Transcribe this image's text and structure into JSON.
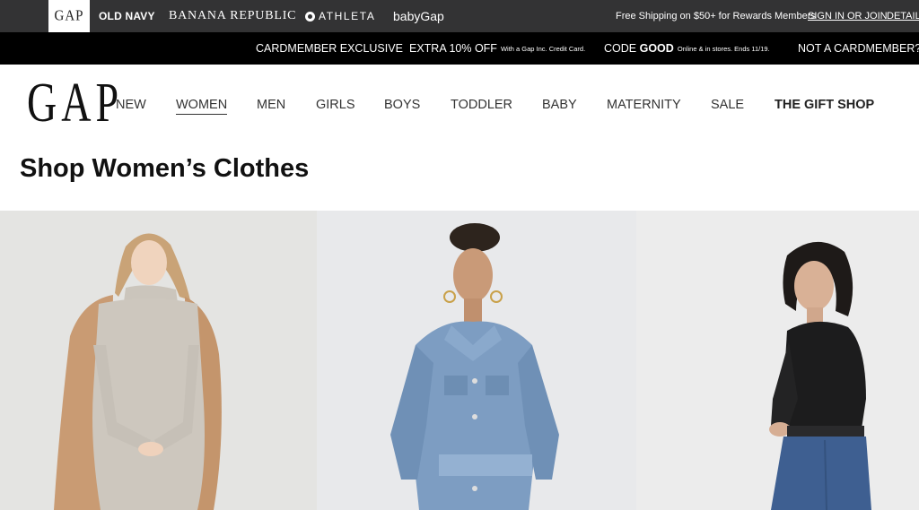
{
  "brand_bar": {
    "brands": {
      "gap": "GAP",
      "old_navy": "OLD NAVY",
      "banana_republic": "BANANA REPUBLIC",
      "athleta": "ATHLETA",
      "babygap": "babyGap"
    },
    "rewards_text": "Free Shipping on $50+ for Rewards Members",
    "signin": "SIGN IN OR JOIN",
    "details": "DETAILS",
    "background_color": "#333334"
  },
  "promo_bar": {
    "cardmember": "CARDMEMBER EXCLUSIVE",
    "extra_off": "EXTRA 10% OFF",
    "extra_off_note": "With a Gap Inc. Credit Card.",
    "code_prefix": "CODE",
    "code": "GOOD",
    "code_note": "Online & in stores. Ends 11/19.",
    "not_cardmember": "NOT A CARDMEMBER?",
    "background_color": "#000000"
  },
  "header": {
    "logo": "GAP",
    "nav": [
      {
        "label": "NEW"
      },
      {
        "label": "WOMEN",
        "active": true
      },
      {
        "label": "MEN"
      },
      {
        "label": "GIRLS"
      },
      {
        "label": "BOYS"
      },
      {
        "label": "TODDLER"
      },
      {
        "label": "BABY"
      },
      {
        "label": "MATERNITY"
      },
      {
        "label": "SALE"
      },
      {
        "label": "THE GIFT SHOP"
      }
    ]
  },
  "page_title": "Shop Women’s Clothes",
  "products": [
    {
      "image": "woman-in-turtleneck-sweater-with-camel-coat"
    },
    {
      "image": "woman-in-denim-shirt-dress"
    },
    {
      "image": "woman-in-black-top-and-jeans"
    }
  ]
}
